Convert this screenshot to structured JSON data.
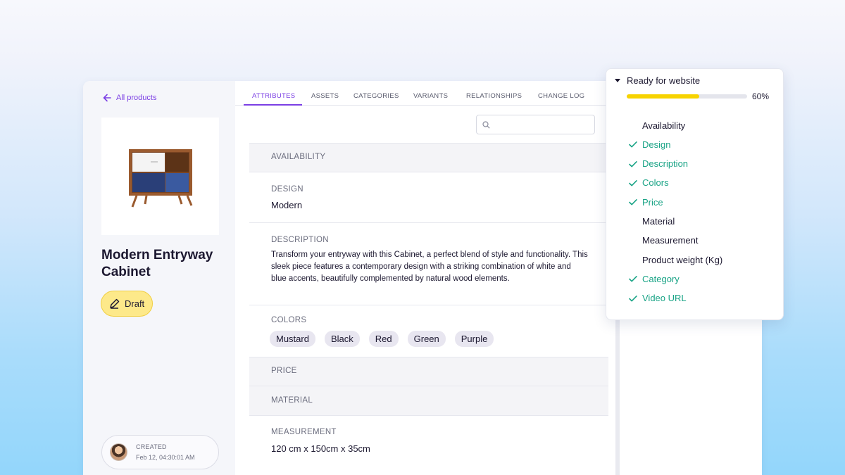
{
  "back_link": "All products",
  "product": {
    "title": "Modern Entryway Cabinet",
    "status": "Draft",
    "created_label": "CREATED",
    "created_date": "Feb 12, 04:30:01 AM"
  },
  "tabs": [
    "ATTRIBUTES",
    "ASSETS",
    "CATEGORIES",
    "VARIANTS",
    "RELATIONSHIPS",
    "CHANGE LOG"
  ],
  "active_tab": "ATTRIBUTES",
  "search": {
    "placeholder": ""
  },
  "attributes": {
    "availability": {
      "label": "AVAILABILITY"
    },
    "design": {
      "label": "DESIGN",
      "value": "Modern"
    },
    "description": {
      "label": "DESCRIPTION",
      "value": "Transform your entryway with this Cabinet, a perfect blend of style and functionality. This sleek piece features a contemporary design with a striking combination of white and blue accents, beautifully complemented by natural wood elements."
    },
    "colors": {
      "label": "COLORS",
      "values": [
        "Mustard",
        "Black",
        "Red",
        "Green",
        "Purple"
      ]
    },
    "price": {
      "label": "PRICE"
    },
    "material": {
      "label": "MATERIAL"
    },
    "measurement": {
      "label": "MEASUREMENT",
      "value": "120 cm x 150cm x 35cm"
    }
  },
  "readiness": {
    "title": "Ready for website",
    "percent_label": "60%",
    "progress": 0.6,
    "items": [
      {
        "label": "Availability",
        "done": false
      },
      {
        "label": "Design",
        "done": true
      },
      {
        "label": "Description",
        "done": true
      },
      {
        "label": "Colors",
        "done": true
      },
      {
        "label": "Price",
        "done": true
      },
      {
        "label": "Material",
        "done": false
      },
      {
        "label": "Measurement",
        "done": false
      },
      {
        "label": "Product weight (Kg)",
        "done": false
      },
      {
        "label": "Category",
        "done": true
      },
      {
        "label": "Video URL",
        "done": true
      }
    ]
  },
  "colors": {
    "accent": "#7b3fe4",
    "success": "#18a385",
    "progress": "#f7d300",
    "draft_badge": "#fde98a"
  },
  "icons": {
    "back": "arrow-left-icon",
    "status": "pencil-icon",
    "search": "search-icon",
    "caret": "caret-down-icon",
    "check": "check-icon"
  }
}
